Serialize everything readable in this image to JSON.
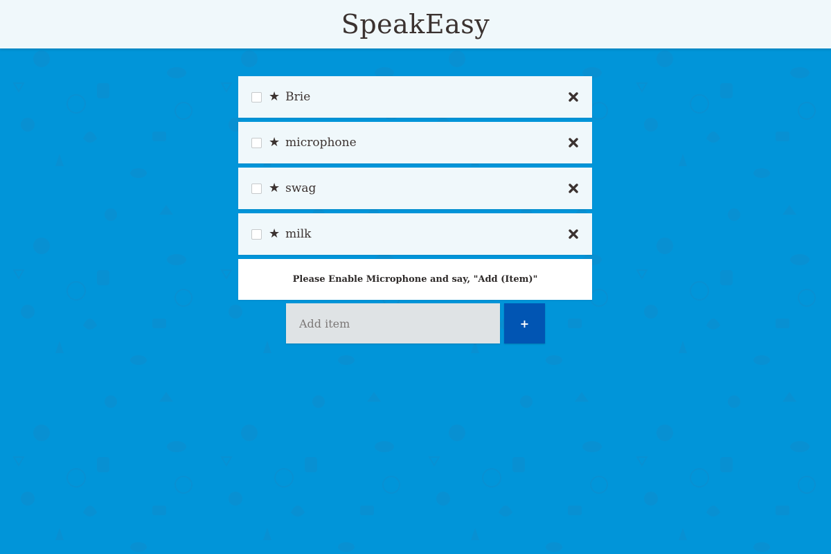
{
  "app": {
    "title": "SpeakEasy"
  },
  "colors": {
    "background": "#0195d9",
    "header": "#f0f8fb",
    "item_bg": "#f0f8fb",
    "text": "#3b3230",
    "add_button": "#0155b3",
    "input_bg": "#dfe3e5"
  },
  "list": {
    "items": [
      {
        "label": "Brie",
        "checked": false,
        "starred": true,
        "star_icon": "star-icon",
        "delete_icon": "close-icon"
      },
      {
        "label": "microphone",
        "checked": false,
        "starred": true,
        "star_icon": "star-icon",
        "delete_icon": "close-icon"
      },
      {
        "label": "swag",
        "checked": false,
        "starred": true,
        "star_icon": "star-icon",
        "delete_icon": "close-icon"
      },
      {
        "label": "milk",
        "checked": false,
        "starred": true,
        "star_icon": "star-icon",
        "delete_icon": "close-icon"
      }
    ]
  },
  "notice": {
    "text": "Please Enable Microphone and say, \"Add (Item)\""
  },
  "add_form": {
    "placeholder": "Add item",
    "value": "",
    "button_label": "+"
  }
}
